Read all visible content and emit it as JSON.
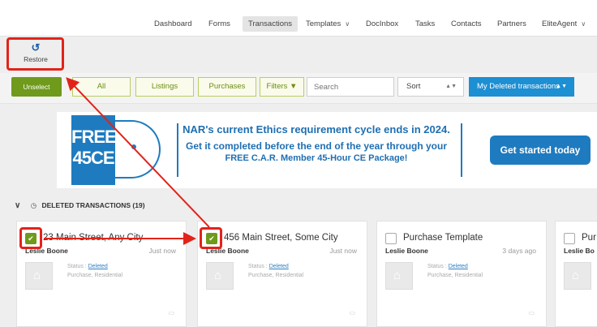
{
  "nav": {
    "dashboard": "Dashboard",
    "forms": "Forms",
    "transactions": "Transactions",
    "templates": "Templates",
    "docinbox": "DocInbox",
    "tasks": "Tasks",
    "contacts": "Contacts",
    "partners": "Partners",
    "user": "EliteAgent"
  },
  "toolbar": {
    "restore_icon": "undo-icon",
    "restore_label": "Restore"
  },
  "filters": {
    "unselect": "Unselect",
    "all": "All",
    "listings": "Listings",
    "purchases": "Purchases",
    "filters": "Filters",
    "search_placeholder": "Search",
    "sort": "Sort",
    "view": "My Deleted transactions"
  },
  "banner": {
    "badge_line1": "FREE",
    "badge_line2": "45CE",
    "line1": "NAR's current Ethics requirement cycle ends in 2024.",
    "line2": "Get it completed before the end of the year through your",
    "line3": "FREE C.A.R. Member 45-Hour CE Package!",
    "cta": "Get started today"
  },
  "section": {
    "title": "DELETED TRANSACTIONS (19)"
  },
  "cards": [
    {
      "title": "23 Main Street, Any City",
      "agent": "Leslie Boone",
      "time": "Just now",
      "status_label": "Status :",
      "status": "Deleted",
      "type": "Purchase, Residential",
      "checked": true
    },
    {
      "title": "456 Main Street, Some City",
      "agent": "Leslie Boone",
      "time": "Just now",
      "status_label": "Status :",
      "status": "Deleted",
      "type": "Purchase, Residential",
      "checked": true
    },
    {
      "title": "Purchase Template",
      "agent": "Leslie Boone",
      "time": "3 days ago",
      "status_label": "Status :",
      "status": "Deleted",
      "type": "Purchase, Residential",
      "checked": false
    },
    {
      "title": "Pur",
      "agent": "Leslie Bo",
      "time": "",
      "status_label": "",
      "status": "",
      "type": "",
      "checked": false
    }
  ],
  "colors": {
    "accent_green": "#6f9a1c",
    "accent_blue": "#1d8fd3",
    "annotation_red": "#e2231a"
  }
}
